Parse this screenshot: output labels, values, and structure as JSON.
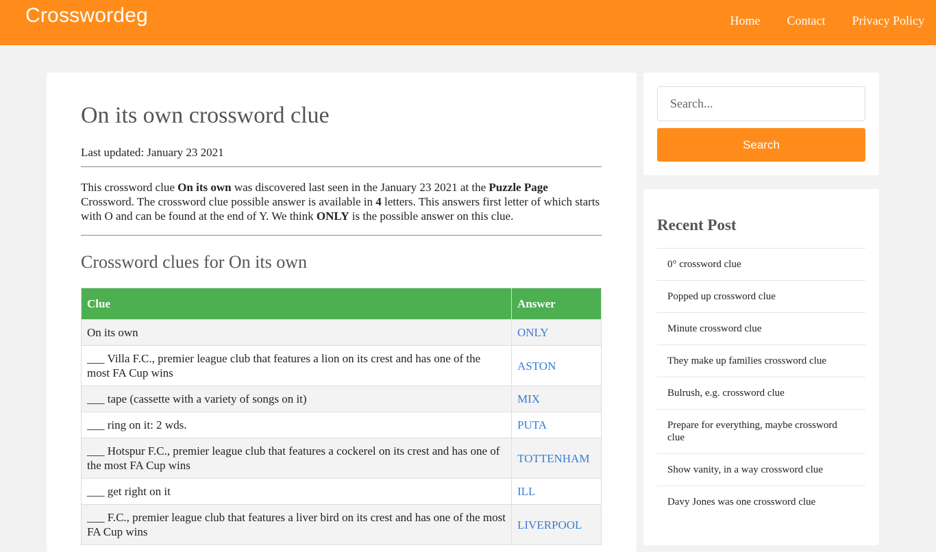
{
  "header": {
    "logo": "Crosswordeg",
    "nav": [
      "Home",
      "Contact",
      "Privacy Policy"
    ]
  },
  "article": {
    "title": "On its own crossword clue",
    "updated": "Last updated: January 23 2021",
    "desc": {
      "p1": "This crossword clue ",
      "clue": "On its own",
      "p2": " was discovered last seen in the January 23 2021 at the ",
      "source": "Puzzle Page",
      "p3": " Crossword. The crossword clue possible answer is available in ",
      "letters": "4",
      "p4": " letters. This answers first letter of which starts with O and can be found at the end of Y. We think ",
      "answer": "ONLY",
      "p5": " is the possible answer on this clue."
    },
    "subtitle": "Crossword clues for On its own"
  },
  "table": {
    "headers": [
      "Clue",
      "Answer"
    ],
    "rows": [
      {
        "clue": "On its own",
        "answer": "ONLY"
      },
      {
        "clue": "___ Villa F.C., premier league club that features a lion on its crest and has one of the most FA Cup wins",
        "answer": "ASTON"
      },
      {
        "clue": "___ tape (cassette with a variety of songs on it)",
        "answer": "MIX"
      },
      {
        "clue": "___ ring on it: 2 wds.",
        "answer": "PUTA"
      },
      {
        "clue": "___ Hotspur F.C., premier league club that features a cockerel on its crest and has one of the most FA Cup wins",
        "answer": "TOTTENHAM"
      },
      {
        "clue": "___ get right on it",
        "answer": "ILL"
      },
      {
        "clue": "___ F.C., premier league club that features a liver bird on its crest and has one of the most FA Cup wins",
        "answer": "LIVERPOOL"
      }
    ]
  },
  "sidebar": {
    "search_placeholder": "Search...",
    "search_button": "Search",
    "recent_title": "Recent Post",
    "recent": [
      "0° crossword clue",
      "Popped up crossword clue",
      "Minute crossword clue",
      "They make up families crossword clue",
      "Bulrush, e.g. crossword clue",
      "Prepare for everything, maybe crossword clue",
      "Show vanity, in a way crossword clue",
      "Davy Jones was one crossword clue"
    ]
  },
  "colors": {
    "brand": "#ff8c1a",
    "table_header": "#4caf50",
    "link": "#3a7bd5"
  }
}
